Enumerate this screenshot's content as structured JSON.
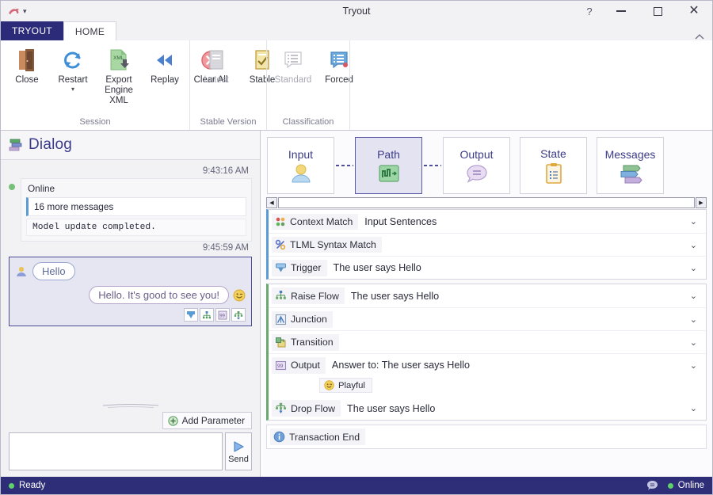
{
  "window": {
    "title": "Tryout",
    "quick_access_icon": "app-bird-icon",
    "quick_access_caret": "▾",
    "help_label": "?",
    "minimize_label": "minimize",
    "maximize_label": "maximize",
    "close_label": "close",
    "ribbon_collapse_icon": "chevron-up-icon"
  },
  "ribbon": {
    "tabs": [
      {
        "label": "TRYOUT",
        "style": "accent"
      },
      {
        "label": "HOME",
        "style": "active"
      }
    ],
    "groups": [
      {
        "name": "Session",
        "label": "Session",
        "buttons": [
          {
            "label": "Close",
            "icon": "door-open-icon",
            "enabled": true,
            "has_caret": false
          },
          {
            "label": "Restart",
            "icon": "refresh-circular-icon",
            "enabled": true,
            "has_caret": true
          },
          {
            "label": "Export Engine XML",
            "icon": "xml-export-icon",
            "enabled": true,
            "has_caret": false
          },
          {
            "label": "Replay",
            "icon": "rewind-icon",
            "enabled": true,
            "has_caret": false
          },
          {
            "label": "Clear All",
            "icon": "clear-x-circle-icon",
            "enabled": true,
            "has_caret": false
          }
        ]
      },
      {
        "name": "Stable Version",
        "label": "Stable Version",
        "buttons": [
          {
            "label": "Latest",
            "icon": "book-grey-icon",
            "enabled": false,
            "has_caret": false
          },
          {
            "label": "Stable",
            "icon": "checked-page-icon",
            "enabled": true,
            "has_caret": false
          }
        ]
      },
      {
        "name": "Classification",
        "label": "Classification",
        "buttons": [
          {
            "label": "Standard",
            "icon": "list-bubble-grey-icon",
            "enabled": false,
            "has_caret": false
          },
          {
            "label": "Forced",
            "icon": "list-bubble-blue-icon",
            "enabled": true,
            "has_caret": false
          }
        ]
      }
    ]
  },
  "dialog": {
    "title": "Dialog",
    "title_icon": "dialog-stack-icon",
    "messages": [
      {
        "timestamp": "9:43:16 AM",
        "kind": "system",
        "status_icon": "online-dot-icon",
        "author": "Online",
        "collapsed_note": "16 more messages",
        "body": "Model update completed."
      },
      {
        "timestamp": "9:45:59 AM",
        "kind": "turn",
        "user_icon": "user-avatar-icon",
        "user_text": "Hello",
        "bot_text": "Hello. It's good to see you!",
        "bot_emoji": "wink-emoji-icon",
        "actions": [
          {
            "name": "trigger-icon"
          },
          {
            "name": "raise-flow-icon"
          },
          {
            "name": "output-icon"
          },
          {
            "name": "drop-flow-icon"
          }
        ]
      }
    ],
    "add_parameter_label": "Add Parameter",
    "add_parameter_icon": "plus-circle-icon",
    "composer_value": "",
    "composer_placeholder": "",
    "send_label": "Send",
    "send_icon": "play-triangle-icon"
  },
  "path_tiles": [
    {
      "label": "Input",
      "icon": "user-avatar-icon",
      "selected": false,
      "connector_after": true
    },
    {
      "label": "Path",
      "icon": "path-wave-icon",
      "selected": true,
      "connector_after": true
    },
    {
      "label": "Output",
      "icon": "speech-bubble-icon",
      "selected": false,
      "connector_after": false
    },
    {
      "label": "State",
      "icon": "clipboard-icon",
      "selected": false,
      "connector_after": false
    },
    {
      "label": "Messages",
      "icon": "messages-bars-icon",
      "selected": false,
      "connector_after": false
    }
  ],
  "hscroll": {
    "left_arrow": "◀",
    "right_arrow": "▶"
  },
  "trace": {
    "groups": [
      {
        "accent": "blue",
        "rows": [
          {
            "icon": "context-match-icon",
            "chip": "Context Match",
            "value": "Input Sentences",
            "chevron": "⌄",
            "expandable": true
          },
          {
            "icon": "percent-icon",
            "chip": "TLML Syntax Match",
            "value": "",
            "chevron": "⌄",
            "expandable": true
          },
          {
            "icon": "trigger-icon",
            "chip": "Trigger",
            "value": "The user says Hello",
            "chevron": "⌄",
            "expandable": true
          }
        ]
      },
      {
        "accent": "green",
        "rows": [
          {
            "icon": "raise-flow-icon",
            "chip": "Raise Flow",
            "value": "The user says Hello",
            "chevron": "⌄",
            "expandable": true
          },
          {
            "icon": "junction-icon",
            "chip": "Junction",
            "value": "",
            "chevron": "⌄",
            "expandable": true
          },
          {
            "icon": "transition-icon",
            "chip": "Transition",
            "value": "",
            "chevron": "⌄",
            "expandable": true
          },
          {
            "icon": "output-icon",
            "chip": "Output",
            "value": "Answer to: The user says Hello",
            "chevron": "⌄",
            "expandable": true,
            "tag": {
              "icon": "wink-emoji-icon",
              "label": "Playful"
            }
          },
          {
            "icon": "drop-flow-icon",
            "chip": "Drop Flow",
            "value": "The user says Hello",
            "chevron": "⌄",
            "expandable": true
          }
        ]
      },
      {
        "accent": "plain",
        "rows": [
          {
            "icon": "info-icon",
            "chip": "Transaction End",
            "value": "",
            "chevron": "",
            "expandable": false
          }
        ]
      }
    ]
  },
  "status_bar": {
    "state_icon": "online-dot-icon",
    "state_label": "Ready",
    "chat_icon": "speech-bubble-icon",
    "connection_icon": "online-dot-icon",
    "connection_label": "Online"
  },
  "colors": {
    "accent_purple": "#2e2e78",
    "tab_accent": "#2b2b7a",
    "selected_tile": "#e3e3f1",
    "online_green": "#5fd06a",
    "blue_rail": "#5b9bd5",
    "green_rail": "#6aa86e"
  }
}
